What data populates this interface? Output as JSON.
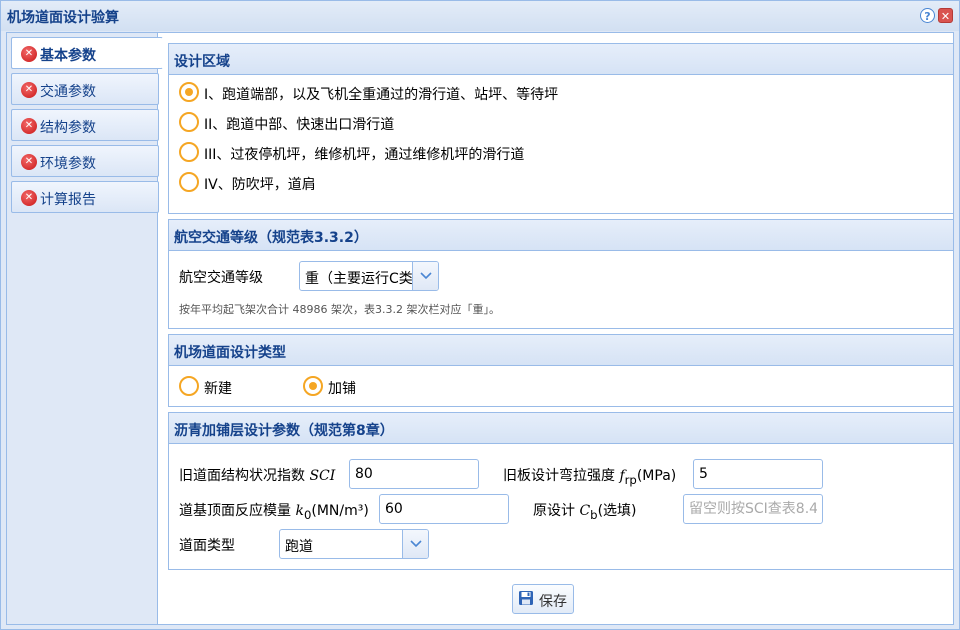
{
  "window": {
    "title": "机场道面设计验算"
  },
  "sidebar": {
    "items": [
      {
        "label": "基本参数",
        "active": true
      },
      {
        "label": "交通参数",
        "active": false
      },
      {
        "label": "结构参数",
        "active": false
      },
      {
        "label": "环境参数",
        "active": false
      },
      {
        "label": "计算报告",
        "active": false
      }
    ]
  },
  "design_area": {
    "title": "设计区域",
    "options": [
      {
        "label": "I、跑道端部，以及飞机全重通过的滑行道、站坪、等待坪",
        "checked": true
      },
      {
        "label": "II、跑道中部、快速出口滑行道",
        "checked": false
      },
      {
        "label": "III、过夜停机坪，维修机坪，通过维修机坪的滑行道",
        "checked": false
      },
      {
        "label": "IV、防吹坪，道肩",
        "checked": false
      }
    ]
  },
  "traffic_level": {
    "title": "航空交通等级（规范表3.3.2）",
    "field_label": "航空交通等级",
    "selected": "重（主要运行C类",
    "note": "按年平均起飞架次合计 48986 架次，表3.3.2 架次栏对应「重」。"
  },
  "design_type": {
    "title": "机场道面设计类型",
    "options": [
      {
        "label": "新建",
        "checked": false
      },
      {
        "label": "加铺",
        "checked": true
      }
    ]
  },
  "overlay_params": {
    "title": "沥青加铺层设计参数（规范第8章）",
    "sci": {
      "label_pre": "旧道面结构状况指数 ",
      "label_sym": "SCI",
      "value": "80"
    },
    "frp": {
      "label_pre": "旧板设计弯拉强度 ",
      "label_sym": "f",
      "label_sub": "rp",
      "label_post": "(MPa)",
      "value": "5"
    },
    "k0": {
      "label_pre": "道基顶面反应模量 ",
      "label_sym": "k",
      "label_sub": "0",
      "label_post": "(MN/m³)",
      "value": "60"
    },
    "cb": {
      "label_pre": "原设计 ",
      "label_sym": "C",
      "label_sub": "b",
      "label_post": "(选填)",
      "placeholder": "留空则按SCI查表8.4."
    },
    "surface_type": {
      "label": "道面类型",
      "selected": "跑道"
    }
  },
  "save_button": {
    "label": "保存"
  },
  "colors": {
    "accent": "#f5a623",
    "header_text": "#15428b",
    "border": "#99bbe8",
    "close": "#d9534f"
  }
}
